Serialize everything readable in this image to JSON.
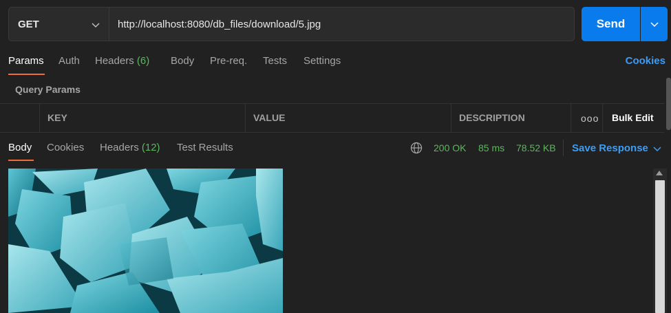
{
  "request": {
    "method": "GET",
    "url": "http://localhost:8080/db_files/download/5.jpg",
    "send_label": "Send"
  },
  "req_tabs": [
    {
      "label": "Params"
    },
    {
      "label": "Auth"
    },
    {
      "label": "Headers",
      "count": "(6)"
    },
    {
      "label": "Body"
    },
    {
      "label": "Pre-req."
    },
    {
      "label": "Tests"
    },
    {
      "label": "Settings"
    }
  ],
  "cookies_label": "Cookies",
  "query_params_label": "Query Params",
  "params_table": {
    "columns": [
      "KEY",
      "VALUE",
      "DESCRIPTION"
    ],
    "more_label": "ooo",
    "bulk_edit_label": "Bulk Edit"
  },
  "resp_tabs": [
    {
      "label": "Body"
    },
    {
      "label": "Cookies"
    },
    {
      "label": "Headers",
      "count": "(12)"
    },
    {
      "label": "Test Results"
    }
  ],
  "response_status": {
    "status": "200 OK",
    "time": "85 ms",
    "size": "78.52 KB"
  },
  "save_response_label": "Save Response",
  "colors": {
    "accent": "#097bed",
    "tab_underline": "#f26b3a",
    "success": "#5cb85c",
    "link": "#3d9df5"
  },
  "icons": {
    "method_dropdown": "chevron-down-icon",
    "send_dropdown": "chevron-down-icon",
    "globe": "globe-icon",
    "save_dropdown": "chevron-down-icon"
  }
}
